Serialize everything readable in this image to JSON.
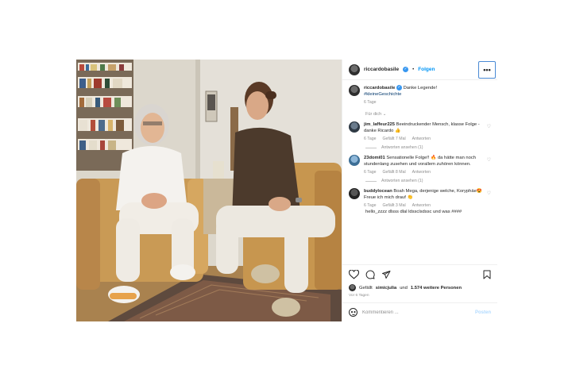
{
  "header": {
    "username": "riccardobasile",
    "separator": "•",
    "follow_label": "Folgen",
    "more_label": "•••"
  },
  "caption": {
    "username": "riccardobasile",
    "text": "Danke Legende!",
    "hashtag": "#kleineGeschichte",
    "time": "6 Tage"
  },
  "for_you_label": "Für dich ⌄",
  "comments": [
    {
      "username": "jim_laffeur225",
      "text": "Beeindruckender Mensch, klasse Folge - danke Ricardo 👍",
      "time": "6 Tage",
      "likes": "Gefällt 7 Mal",
      "reply": "Antworten",
      "view_replies": "Antworten ansehen (1)"
    },
    {
      "username": "23domi01",
      "text": "Sensationelle Folge!! 🔥 da hätte man noch stundenlang zusehen und vorallem zuhören können.",
      "time": "6 Tage",
      "likes": "Gefällt 8 Mal",
      "reply": "Antworten",
      "view_replies": "Antworten ansehen (1)"
    },
    {
      "username": "buddylocean",
      "text": "Boah Mega, derjenige welche, Koryphäe😍 Freue ich mich drauf 👏",
      "time": "6 Tage",
      "likes": "Gefällt 3 Mal",
      "reply": "Antworten"
    }
  ],
  "cut_comment": "hello_zzzz dlsss dlal ldssclsdssc und was ####",
  "likes": {
    "prefix": "Gefällt",
    "user": "simicjulia",
    "middle": "und",
    "count": "1.574 weitere Personen"
  },
  "time_ago": "Vor 6 Tagen",
  "add_comment": {
    "placeholder": "Kommentieren ...",
    "post_label": "Posten"
  },
  "icons": {
    "like": "heart-icon",
    "comment": "comment-icon",
    "share": "share-icon",
    "save": "bookmark-icon",
    "emoji": "emoji-icon",
    "verified": "verified-icon"
  },
  "colors": {
    "accent": "#0095f6",
    "verified": "#3897f0",
    "muted": "#8e8e8e",
    "text": "#262626"
  }
}
